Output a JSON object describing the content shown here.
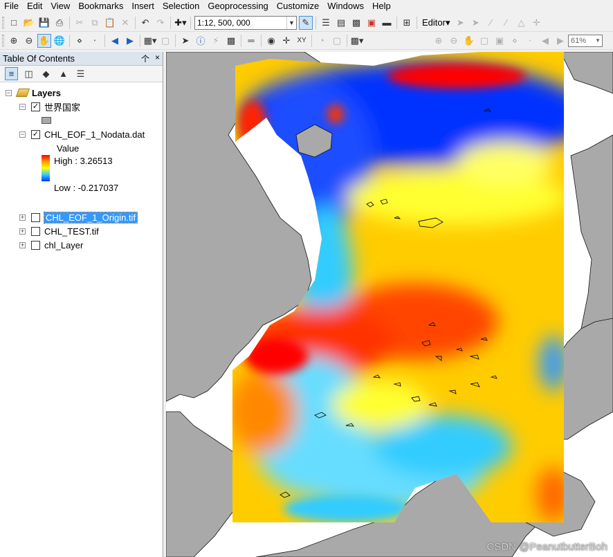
{
  "menubar": {
    "items": [
      "File",
      "Edit",
      "View",
      "Bookmarks",
      "Insert",
      "Selection",
      "Geoprocessing",
      "Customize",
      "Windows",
      "Help"
    ]
  },
  "toolbar": {
    "scale_value": "1:12, 500, 000",
    "editor_label": "Editor▾",
    "zoom_value": "61%"
  },
  "toc": {
    "title": "Table Of Contents",
    "pin_glyph": "个",
    "close_glyph": "×",
    "layers_label": "Layers",
    "layer1_name": "世界国家",
    "layer2_name": "CHL_EOF_1_Nodata.dat",
    "legend_field": "Value",
    "legend_high": "High : 3.26513",
    "legend_low": "Low : -0.217037",
    "layer3_name": "CHL_EOF_1_Origin.tif",
    "layer4_name": "CHL_TEST.tif",
    "layer5_name": "chl_Layer"
  },
  "map": {
    "watermark": "CSDN @PeanutbutterBoh",
    "land_color": "#a9a9a9",
    "colors": {
      "low": "#0033ff",
      "mid_low": "#33ccff",
      "mid": "#ffff00",
      "mid_high": "#ffcc00",
      "high": "#ff0000"
    }
  }
}
